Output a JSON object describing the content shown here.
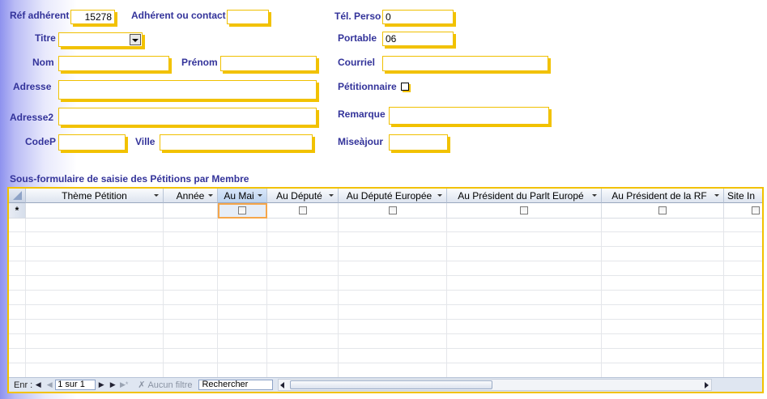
{
  "form": {
    "ref_label": "Réf adhérent",
    "ref_value": "15278",
    "contact_label": "Adhérent ou contact",
    "contact_value": "",
    "tel_label": "Tél. Perso",
    "tel_value": "0",
    "titre_label": "Titre",
    "titre_value": "",
    "portable_label": "Portable",
    "portable_value": "06",
    "nom_label": "Nom",
    "nom_value": "",
    "prenom_label": "Prénom",
    "prenom_value": "",
    "courriel_label": "Courriel",
    "courriel_value": "",
    "adresse_label": "Adresse",
    "adresse_value": "",
    "petitionnaire_label": "Pétitionnaire",
    "petitionnaire_checked": false,
    "adresse2_label": "Adresse2",
    "adresse2_value": "",
    "remarque_label": "Remarque",
    "remarque_value": "",
    "codep_label": "CodeP",
    "codep_value": "",
    "ville_label": "Ville",
    "ville_value": "",
    "miseajour_label": "Miseàjour",
    "miseajour_value": ""
  },
  "subform": {
    "title": "Sous-formulaire de saisie des Pétitions par Membre",
    "columns": [
      {
        "label": "Thème Pétition"
      },
      {
        "label": "Année"
      },
      {
        "label": "Au Mai"
      },
      {
        "label": "Au Député"
      },
      {
        "label": "Au Député Europée"
      },
      {
        "label": "Au Président du Parlt Europé"
      },
      {
        "label": "Au Président de la RF"
      },
      {
        "label": "Site In"
      }
    ],
    "new_record_marker": "*"
  },
  "navbar": {
    "record_label": "Enr :",
    "record_value": "1 sur 1",
    "filter_label": "Aucun filtre",
    "search_label": "Rechercher"
  },
  "colors": {
    "label": "#33339a",
    "field_border": "#f2c200",
    "selected_cell_outline": "#f5a64b"
  }
}
